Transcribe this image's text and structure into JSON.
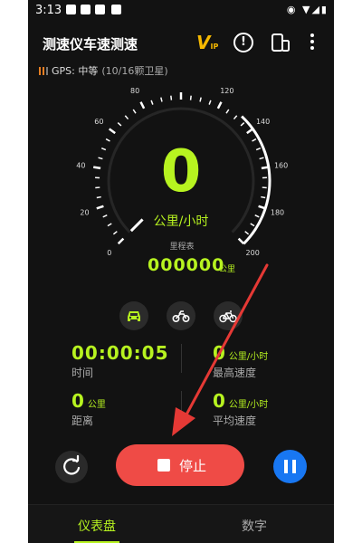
{
  "status_bar": {
    "time": "3:13",
    "right_icons": "◉ ▼◢▮"
  },
  "app_bar": {
    "title": "测速仪车速测速",
    "vip_label": "V",
    "vip_small": "IP",
    "info_glyph": "!",
    "more_glyph": "⋮"
  },
  "gps": {
    "label": "GPS: 中等",
    "satellites": "(10/16颗卫星)"
  },
  "gauge": {
    "ticks": [
      "0",
      "20",
      "40",
      "60",
      "80",
      "100",
      "120",
      "140",
      "160",
      "180",
      "200"
    ],
    "min": 0,
    "max": 200,
    "speed": "0",
    "speed_value": 0,
    "speed_unit": "公里/小时",
    "odometer_label": "里程表",
    "odometer_value": "000000",
    "odometer_unit": "公里"
  },
  "vehicles": [
    {
      "name": "car-icon",
      "selected": true
    },
    {
      "name": "motorcycle-icon",
      "selected": false
    },
    {
      "name": "bicycle-icon",
      "selected": false
    }
  ],
  "stats": {
    "time": {
      "value": "00:00:05",
      "label": "时间"
    },
    "max_speed": {
      "value": "0",
      "unit": "公里/小时",
      "label": "最高速度"
    },
    "distance": {
      "value": "0",
      "unit": "公里",
      "label": "距离"
    },
    "avg_speed": {
      "value": "0",
      "unit": "公里/小时",
      "label": "平均速度"
    }
  },
  "controls": {
    "stop_label": "停止"
  },
  "tabs": [
    {
      "label": "仪表盘",
      "active": true
    },
    {
      "label": "数字",
      "active": false
    }
  ],
  "colors": {
    "accent": "#b7f320",
    "stop": "#ef4b46",
    "pause": "#1877f2",
    "annotation_arrow": "#e53935"
  }
}
